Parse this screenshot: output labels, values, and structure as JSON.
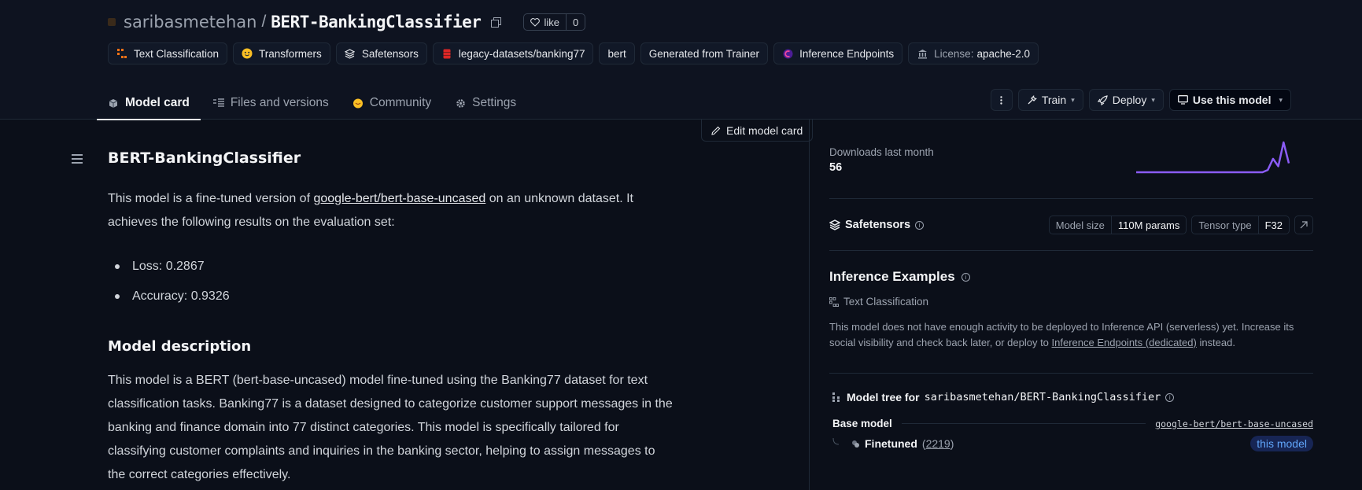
{
  "header": {
    "owner": "saribasmetehan",
    "separator": "/",
    "repo": "BERT-BankingClassifier",
    "like_label": "like",
    "like_count": "0"
  },
  "tags": [
    {
      "label": "Text Classification",
      "icon": "text-classification-icon"
    },
    {
      "label": "Transformers",
      "icon": "hugging-face-icon"
    },
    {
      "label": "Safetensors",
      "icon": "safetensors-icon"
    },
    {
      "label": "legacy-datasets/banking77",
      "icon": "dataset-icon"
    },
    {
      "label": "bert",
      "icon": ""
    },
    {
      "label": "Generated from Trainer",
      "icon": ""
    },
    {
      "label": "Inference Endpoints",
      "icon": "inference-endpoints-icon"
    },
    {
      "label_prefix": "License:",
      "label": "apache-2.0",
      "icon": "license-icon"
    }
  ],
  "tabs": [
    {
      "label": "Model card",
      "icon": "cube-icon",
      "active": true
    },
    {
      "label": "Files and versions",
      "icon": "files-icon"
    },
    {
      "label": "Community",
      "icon": "community-icon"
    },
    {
      "label": "Settings",
      "icon": "gear-icon"
    }
  ],
  "actions": {
    "train": "Train",
    "deploy": "Deploy",
    "use_model": "Use this model"
  },
  "edit_card_label": "Edit model card",
  "content": {
    "title": "BERT-BankingClassifier",
    "intro_pre": "This model is a fine-tuned version of ",
    "intro_link": "google-bert/bert-base-uncased",
    "intro_post": " on an unknown dataset. It achieves the following results on the evaluation set:",
    "results": [
      "Loss: 0.2867",
      "Accuracy: 0.9326"
    ],
    "section_title": "Model description",
    "description": "This model is a BERT (bert-base-uncased) model fine-tuned using the Banking77 dataset for text classification tasks. Banking77 is a dataset designed to categorize customer support messages in the banking and finance domain into 77 distinct categories. This model is specifically tailored for classifying customer complaints and inquiries in the banking sector, helping to assign messages to the correct categories effectively."
  },
  "sidebar": {
    "downloads_label": "Downloads last month",
    "downloads_value": "56",
    "downloads_sparkline": [
      0,
      0,
      0,
      0,
      0,
      0,
      0,
      0,
      0,
      0,
      0,
      0,
      0,
      0,
      0,
      0,
      0,
      0,
      0,
      0,
      0,
      0,
      0,
      0,
      0,
      3,
      18,
      8,
      40,
      12
    ],
    "safetensors_label": "Safetensors",
    "model_size_label": "Model size",
    "model_size_value": "110M params",
    "tensor_type_label": "Tensor type",
    "tensor_type_value": "F32",
    "inference_title": "Inference Examples",
    "inference_task": "Text Classification",
    "inference_desc_pre": "This model does not have enough activity to be deployed to Inference API (serverless) yet. Increase its social visibility and check back later, or deploy to ",
    "inference_desc_link": "Inference Endpoints (dedicated)",
    "inference_desc_post": " instead.",
    "model_tree_label": "Model tree for",
    "model_tree_repo": "saribasmetehan/BERT-BankingClassifier",
    "base_model_label": "Base model",
    "base_model_link": "google-bert/bert-base-uncased",
    "finetuned_label": "Finetuned",
    "finetuned_count": "2219",
    "this_model_label": "this model",
    "accent_color": "#8b5cf6"
  }
}
